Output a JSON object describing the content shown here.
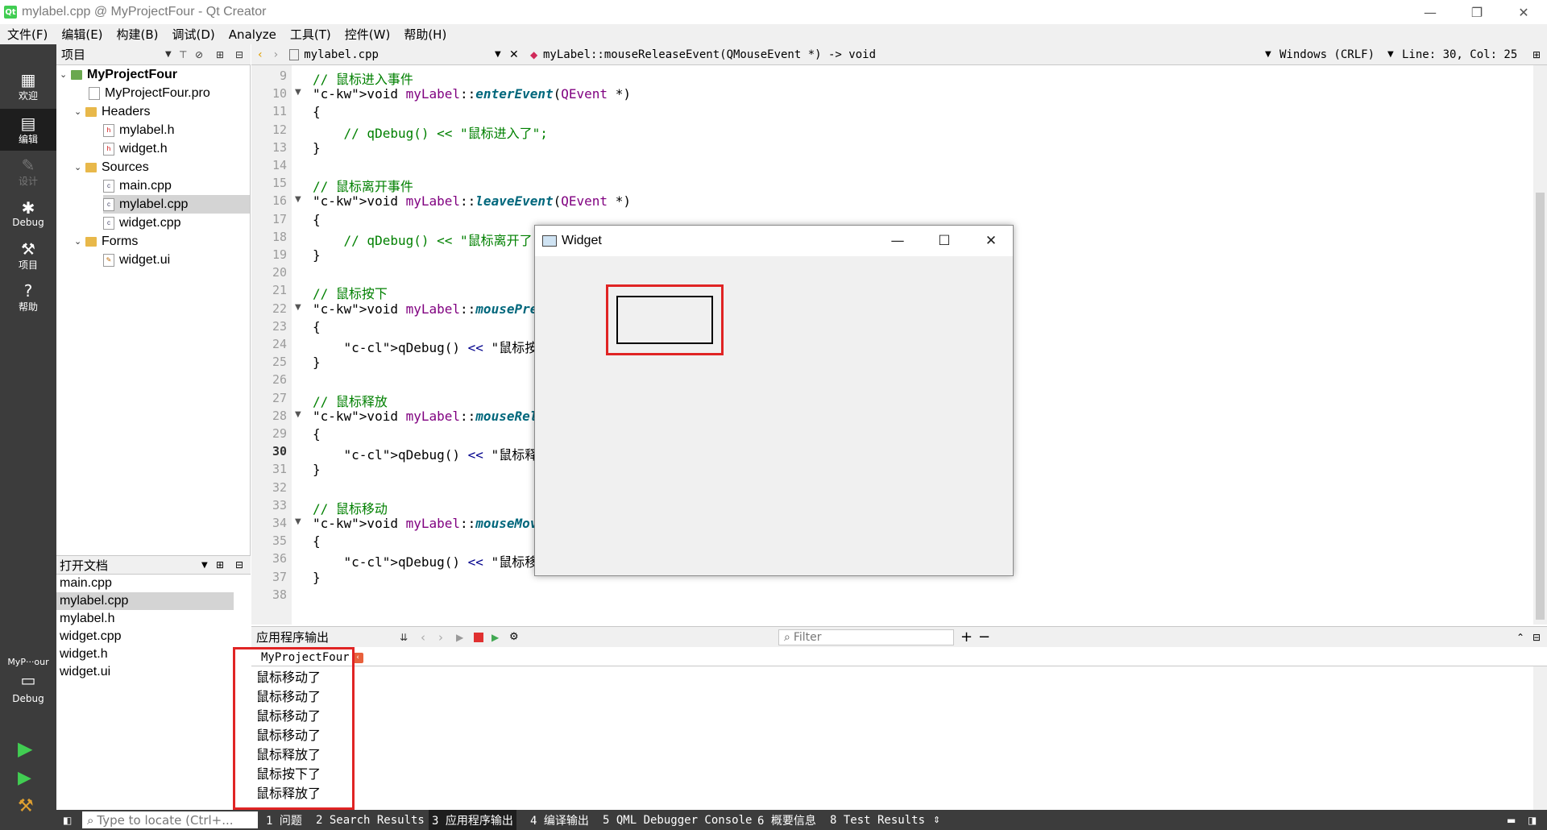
{
  "window": {
    "title": "mylabel.cpp @ MyProjectFour - Qt Creator",
    "logo_text": "Qt",
    "controls": {
      "minimize": "—",
      "restore": "❐",
      "close": "✕"
    }
  },
  "menu": [
    "文件(F)",
    "编辑(E)",
    "构建(B)",
    "调试(D)",
    "Analyze",
    "工具(T)",
    "控件(W)",
    "帮助(H)"
  ],
  "modes": [
    {
      "label": "欢迎",
      "icon": "grid-icon"
    },
    {
      "label": "编辑",
      "icon": "edit-icon"
    },
    {
      "label": "设计",
      "icon": "pencil-icon"
    },
    {
      "label": "Debug",
      "icon": "bug-icon"
    },
    {
      "label": "项目",
      "icon": "wrench-icon"
    },
    {
      "label": "帮助",
      "icon": "help-icon"
    }
  ],
  "kit": {
    "name": "MyP···our",
    "config": "Debug"
  },
  "project_panel": {
    "title": "项目",
    "tree": [
      {
        "label": "MyProjectFour",
        "type": "project",
        "level": 0,
        "expanded": true
      },
      {
        "label": "MyProjectFour.pro",
        "type": "pro",
        "level": 1
      },
      {
        "label": "Headers",
        "type": "folder",
        "level": 1,
        "expanded": true
      },
      {
        "label": "mylabel.h",
        "type": "h",
        "level": 2
      },
      {
        "label": "widget.h",
        "type": "h",
        "level": 2
      },
      {
        "label": "Sources",
        "type": "folder",
        "level": 1,
        "expanded": true
      },
      {
        "label": "main.cpp",
        "type": "cpp",
        "level": 2
      },
      {
        "label": "mylabel.cpp",
        "type": "cpp",
        "level": 2,
        "selected": true
      },
      {
        "label": "widget.cpp",
        "type": "cpp",
        "level": 2
      },
      {
        "label": "Forms",
        "type": "folder",
        "level": 1,
        "expanded": true
      },
      {
        "label": "widget.ui",
        "type": "ui",
        "level": 2
      }
    ]
  },
  "open_docs": {
    "title": "打开文档",
    "items": [
      "main.cpp",
      "mylabel.cpp",
      "mylabel.h",
      "widget.cpp",
      "widget.h",
      "widget.ui"
    ],
    "selected": "mylabel.cpp"
  },
  "editor_toolbar": {
    "file": "mylabel.cpp",
    "symbol": "myLabel::mouseReleaseEvent(QMouseEvent *) -> void",
    "line_ending": "Windows (CRLF)",
    "position": "Line: 30, Col: 25"
  },
  "code": {
    "current_line": 30,
    "lines": [
      {
        "n": 9,
        "text": "// 鼠标进入事件"
      },
      {
        "n": 10,
        "text": "void myLabel::enterEvent(QEvent *)",
        "fold": true
      },
      {
        "n": 11,
        "text": "{"
      },
      {
        "n": 12,
        "text": "    // qDebug() << \"鼠标进入了\";"
      },
      {
        "n": 13,
        "text": "}"
      },
      {
        "n": 14,
        "text": ""
      },
      {
        "n": 15,
        "text": "// 鼠标离开事件"
      },
      {
        "n": 16,
        "text": "void myLabel::leaveEvent(QEvent *)",
        "fold": true
      },
      {
        "n": 17,
        "text": "{"
      },
      {
        "n": 18,
        "text": "    // qDebug() << \"鼠标离开了\";"
      },
      {
        "n": 19,
        "text": "}"
      },
      {
        "n": 20,
        "text": ""
      },
      {
        "n": 21,
        "text": "// 鼠标按下"
      },
      {
        "n": 22,
        "text": "void myLabel::mousePressEvent(QMouseEvent *ev)",
        "fold": true
      },
      {
        "n": 23,
        "text": "{"
      },
      {
        "n": 24,
        "text": "    qDebug() << \"鼠标按下了\";"
      },
      {
        "n": 25,
        "text": "}"
      },
      {
        "n": 26,
        "text": ""
      },
      {
        "n": 27,
        "text": "// 鼠标释放"
      },
      {
        "n": 28,
        "text": "void myLabel::mouseReleaseEvent(QMouseEvent *ev)",
        "fold": true
      },
      {
        "n": 29,
        "text": "{"
      },
      {
        "n": 30,
        "text": "    qDebug() << \"鼠标释放了\";"
      },
      {
        "n": 31,
        "text": "}"
      },
      {
        "n": 32,
        "text": ""
      },
      {
        "n": 33,
        "text": "// 鼠标移动"
      },
      {
        "n": 34,
        "text": "void myLabel::mouseMoveEvent(QMouseEvent *ev)",
        "fold": true
      },
      {
        "n": 35,
        "text": "{"
      },
      {
        "n": 36,
        "text": "    qDebug() << \"鼠标移动了\";"
      },
      {
        "n": 37,
        "text": "}"
      },
      {
        "n": 38,
        "text": ""
      }
    ]
  },
  "widget_window": {
    "title": "Widget",
    "controls": {
      "minimize": "—",
      "maximize": "☐",
      "close": "✕"
    }
  },
  "output_pane": {
    "title": "应用程序输出",
    "filter_placeholder": "Filter",
    "tab": "MyProjectFour",
    "lines": [
      "鼠标移动了",
      "鼠标移动了",
      "鼠标移动了",
      "鼠标移动了",
      "鼠标释放了",
      "鼠标按下了",
      "鼠标释放了"
    ]
  },
  "status_bar": {
    "locate_placeholder": "Type to locate (Ctrl+...",
    "tabs": [
      "1 问题",
      "2 Search Results",
      "3 应用程序输出",
      "4 编译输出",
      "5 QML Debugger Console",
      "6 概要信息",
      "8 Test Results"
    ],
    "active_tab": "3 应用程序输出"
  },
  "colors": {
    "annotation_red": "#e02424",
    "sidebar_bg": "#3c3c3c",
    "comment": "#008000",
    "keyword": "#808000",
    "type": "#800080"
  }
}
